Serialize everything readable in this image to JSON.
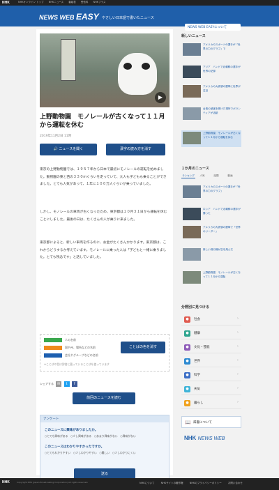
{
  "topbar": {
    "logo": "NHK",
    "links": [
      "NHKオンライン トップ",
      "NHKニュース",
      "番組表",
      "受信料",
      "NHKプラス"
    ]
  },
  "banner": {
    "title_a": "NEWS WEB",
    "title_b": "EASY",
    "tagline": "やさしい日本語で書いたニュース",
    "about": "NEWS WEB EASYについて"
  },
  "article": {
    "headline": "上野動物園　モノレールが古くなって１１月から運転を休む",
    "date": "2019年11月2日 11時",
    "listen_label": "ニュースを聞く",
    "reading_label": "漢字の読み方を消す",
    "p1": "東京の上野動物園では、１９５７年から日本で最初にモノレールの運転を始めました。動物園の東と西の３３０ｍぐらいを走っていて、大人も子どもも乗ることができました。とても人気があって、１年に１００万人ぐらいが乗っていました。",
    "p2": "しかし、モノレールの車両が古くなったため、東京都は１０月３１日から運転を休むことにしました。最後の日は、たくさんの人が乗りに来ました。",
    "p3": "東京都によると、新しい車両を作るのに、お金がたくさんかかります。東京都は、これからどうするか考えています。モノレールに乗った人は「子どもと一緒に乗りました。とても残念です」と話していました。"
  },
  "legend": {
    "items": [
      {
        "color": "#3aa84e",
        "label": "人の名前"
      },
      {
        "color": "#f08a1c",
        "label": "国や州、場所などの名前"
      },
      {
        "color": "#1d5fb0",
        "label": "会社やグループなどの名前"
      }
    ],
    "color_button": "ことばの色を消す",
    "note": "※ことばの色は辞書に載っていることばを使っています"
  },
  "share": {
    "label": "シェアする"
  },
  "prev_button": "前回のニュースを読む",
  "survey": {
    "title": "アンケート",
    "q1": "このニュースに興味がありましたか。",
    "q1_opts": "○とても興味がある　○少し興味がある　○あまり興味がない　○興味がない",
    "q2": "このニュースはわかりやすかったですか。",
    "q2_opts": "○とてもわかりやすい　○少しわかりやすい　○難しい　○少しわかりにくい",
    "submit": "送る"
  },
  "sidebar": {
    "new_heading": "新しいニュース",
    "new_items": [
      "アメリカのスポーツの選手が「世界の力のグラブ」で",
      "アジア　ハンドで北朝鮮の選手が世界の記録",
      "アメリカの大統領の選挙に世界が注目",
      "台風の被害を受けた場所でボランティアが活動",
      "上野動物園　モノレールが古くなって１１月から運転を休む"
    ],
    "popular_heading": "１か月のニュース",
    "tabs": [
      "ランキング",
      "人気",
      "話題",
      "動画"
    ],
    "popular_items": [
      "アメリカのスポーツの選手が「世界の力のグラブ」",
      "ロシア　ハンドで北朝鮮の選手が勝った",
      "アメリカの大統領の選挙で「世界のリーダー」",
      "新しい飛行機が空を飛んだ",
      "上野動物園　モノレールが古くなって１１月から運転"
    ],
    "cat_heading": "分野別に見つける",
    "categories": [
      {
        "label": "社会",
        "icon": "society-icon",
        "color": "#e05a4f"
      },
      {
        "label": "健康",
        "icon": "health-icon",
        "color": "#2fa58f"
      },
      {
        "label": "文化・芸能",
        "icon": "culture-icon",
        "color": "#8e5bb8"
      },
      {
        "label": "世界",
        "icon": "world-icon",
        "color": "#2d8ad1"
      },
      {
        "label": "科学",
        "icon": "science-icon",
        "color": "#3d6fc6"
      },
      {
        "label": "天気",
        "icon": "weather-icon",
        "color": "#3fb4d8"
      },
      {
        "label": "暮らし",
        "icon": "life-icon",
        "color": "#f0a11c"
      }
    ],
    "dict": "辞書について",
    "logo_a": "NHK",
    "logo_b": "NEWS WEB"
  },
  "footer": {
    "logo": "NHK",
    "copyright": "Copyright NHK (Japan Broadcasting Corporation) All rights reserved.",
    "links": [
      "NHKについて",
      "NHKサイトの著作権",
      "NHKのプライバシーポリシー",
      "お問い合わせ"
    ]
  }
}
